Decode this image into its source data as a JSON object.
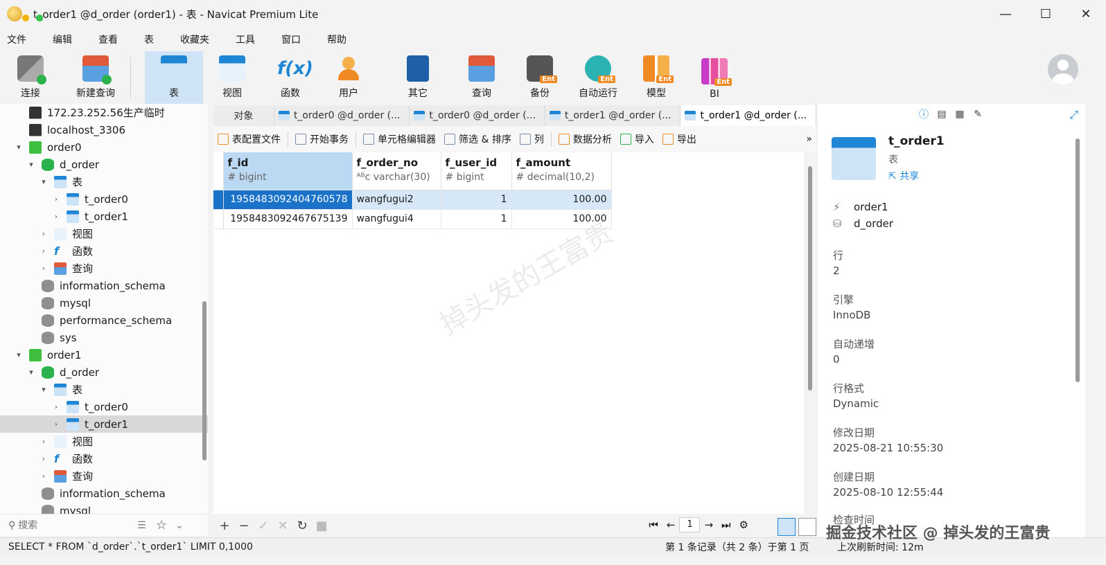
{
  "window": {
    "title": "t_order1 @d_order (order1) - 表 - Navicat Premium Lite",
    "min": "—",
    "max": "☐",
    "close": "✕"
  },
  "menu": [
    "文件",
    "编辑",
    "查看",
    "表",
    "收藏夹",
    "工具",
    "窗口",
    "帮助"
  ],
  "toolbar": {
    "connect": "连接",
    "new_query": "新建查询",
    "table": "表",
    "view": "视图",
    "function": "函数",
    "user": "用户",
    "other": "其它",
    "query": "查询",
    "backup": "备份",
    "automation": "自动运行",
    "model": "模型",
    "bi": "BI",
    "ent_badge": "Ent"
  },
  "sidebar": {
    "items": [
      {
        "label": "172.23.252.56生产临时"
      },
      {
        "label": "localhost_3306"
      },
      {
        "label": "order0"
      },
      {
        "label": "d_order"
      },
      {
        "label": "表"
      },
      {
        "label": "t_order0"
      },
      {
        "label": "t_order1"
      },
      {
        "label": "视图"
      },
      {
        "label": "函数"
      },
      {
        "label": "查询"
      },
      {
        "label": "information_schema"
      },
      {
        "label": "mysql"
      },
      {
        "label": "performance_schema"
      },
      {
        "label": "sys"
      },
      {
        "label": "order1"
      },
      {
        "label": "d_order"
      },
      {
        "label": "表"
      },
      {
        "label": "t_order0"
      },
      {
        "label": "t_order1"
      },
      {
        "label": "视图"
      },
      {
        "label": "函数"
      },
      {
        "label": "查询"
      },
      {
        "label": "information_schema"
      },
      {
        "label": "mysql"
      }
    ],
    "search_placeholder": "搜索"
  },
  "tabs": {
    "objects": "对象",
    "docs": [
      "t_order0 @d_order (...",
      "t_order0 @d_order (...",
      "t_order1 @d_order (...",
      "t_order1 @d_order (..."
    ]
  },
  "objbar": {
    "profile": "表配置文件",
    "begin_tx": "开始事务",
    "cell_editor": "单元格编辑器",
    "filter_sort": "筛选 & 排序",
    "columns": "列",
    "analysis": "数据分析",
    "import": "导入",
    "export": "导出",
    "more": "»"
  },
  "grid": {
    "columns": [
      {
        "name": "f_id",
        "type": "bigint",
        "type_icon": "#"
      },
      {
        "name": "f_order_no",
        "type": "varchar(30)",
        "type_icon": "ᴬᴮc"
      },
      {
        "name": "f_user_id",
        "type": "bigint",
        "type_icon": "#"
      },
      {
        "name": "f_amount",
        "type": "decimal(10,2)",
        "type_icon": "#"
      }
    ],
    "rows": [
      [
        "1958483092404760578",
        "wangfugui2",
        "1",
        "100.00"
      ],
      [
        "1958483092467675139",
        "wangfugui4",
        "1",
        "100.00"
      ]
    ],
    "watermark": "掉头发的王富贵"
  },
  "footer": {
    "add": "+",
    "remove": "−",
    "apply": "✓",
    "cancel": "✕",
    "refresh": "↻",
    "stop": "■",
    "first": "⏮",
    "prev": "←",
    "page": "1",
    "next": "→",
    "last": "⏭",
    "settings": "⚙"
  },
  "status": {
    "sql": "SELECT * FROM `d_order`.`t_order1` LIMIT 0,1000",
    "records": "第 1 条记录（共 2 条）于第 1 页",
    "refresh": "上次刷新时间: 12m"
  },
  "rightpanel": {
    "name": "t_order1",
    "kind": "表",
    "share": "共享",
    "connection": "order1",
    "database": "d_order",
    "fields": [
      {
        "label": "行",
        "value": "2"
      },
      {
        "label": "引擎",
        "value": "InnoDB"
      },
      {
        "label": "自动递增",
        "value": "0"
      },
      {
        "label": "行格式",
        "value": "Dynamic"
      },
      {
        "label": "修改日期",
        "value": "2025-08-21 10:55:30"
      },
      {
        "label": "创建日期",
        "value": "2025-08-10 12:55:44"
      },
      {
        "label": "检查时间",
        "value": ""
      }
    ]
  },
  "overlay_watermark": "掘金技术社区 @ 掉头发的王富贵"
}
